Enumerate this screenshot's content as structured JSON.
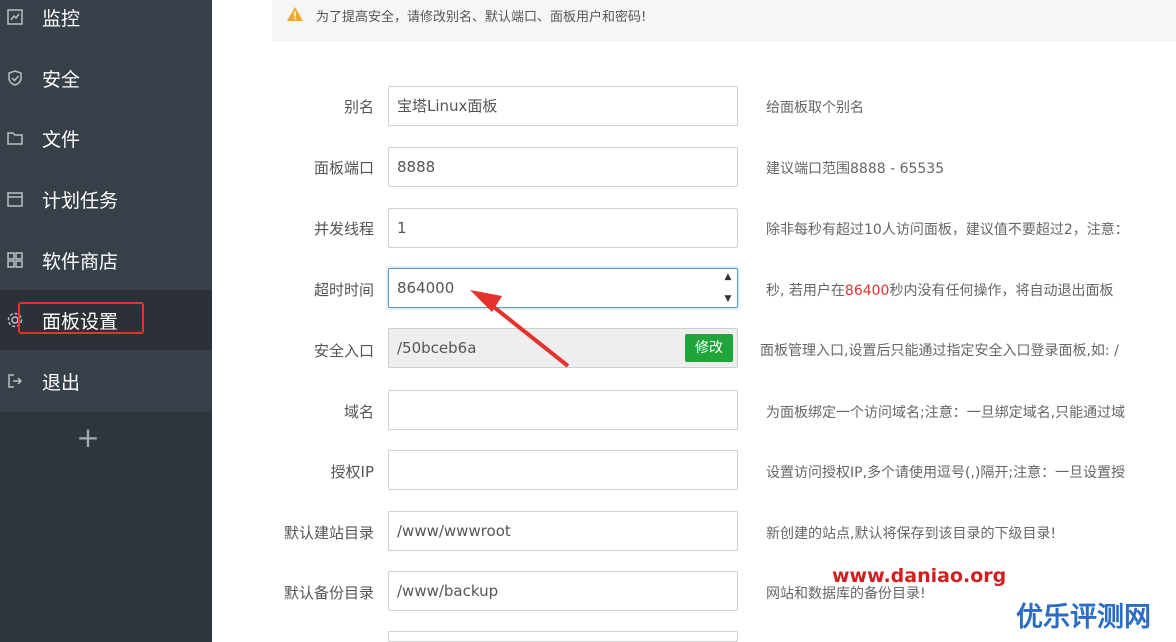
{
  "sidebar": {
    "items": [
      {
        "label": "监控",
        "icon": "monitor-icon"
      },
      {
        "label": "安全",
        "icon": "shield-icon"
      },
      {
        "label": "文件",
        "icon": "folder-icon"
      },
      {
        "label": "计划任务",
        "icon": "calendar-icon"
      },
      {
        "label": "软件商店",
        "icon": "grid-icon"
      },
      {
        "label": "面板设置",
        "icon": "gear-icon",
        "active": true
      },
      {
        "label": "退出",
        "icon": "logout-icon"
      }
    ],
    "add_label": "+"
  },
  "notice": {
    "text": "为了提高安全，请修改别名、默认端口、面板用户和密码!"
  },
  "form": {
    "alias": {
      "label": "别名",
      "value": "宝塔Linux面板",
      "hint": "给面板取个别名"
    },
    "port": {
      "label": "面板端口",
      "value": "8888",
      "hint": "建议端口范围8888 - 65535"
    },
    "threads": {
      "label": "并发线程",
      "value": "1",
      "hint": "除非每秒有超过10人访问面板，建议值不要超过2，注意："
    },
    "timeout": {
      "label": "超时时间",
      "value": "864000",
      "hint_prefix": "秒, 若用户在",
      "hint_value": "86400",
      "hint_suffix": "秒内没有任何操作，将自动退出面板"
    },
    "entry": {
      "label": "安全入口",
      "value": "/50bceb6a",
      "button": "修改",
      "hint": "面板管理入口,设置后只能通过指定安全入口登录面板,如: /"
    },
    "domain": {
      "label": "域名",
      "value": "",
      "hint": "为面板绑定一个访问域名;注意：一旦绑定域名,只能通过域"
    },
    "auth_ip": {
      "label": "授权IP",
      "value": "",
      "hint": "设置访问授权IP,多个请使用逗号(,)隔开;注意：一旦设置授"
    },
    "site_dir": {
      "label": "默认建站目录",
      "value": "/www/wwwroot",
      "hint": "新创建的站点,默认将保存到该目录的下级目录!"
    },
    "backup_dir": {
      "label": "默认备份目录",
      "value": "/www/backup",
      "hint": "网站和数据库的备份目录!"
    }
  },
  "watermark": "www.daniao.org",
  "logo_text": "优乐评测网",
  "colors": {
    "sidebar": "#374048",
    "accent_green": "#20a53a",
    "accent_red": "#e5322d"
  }
}
